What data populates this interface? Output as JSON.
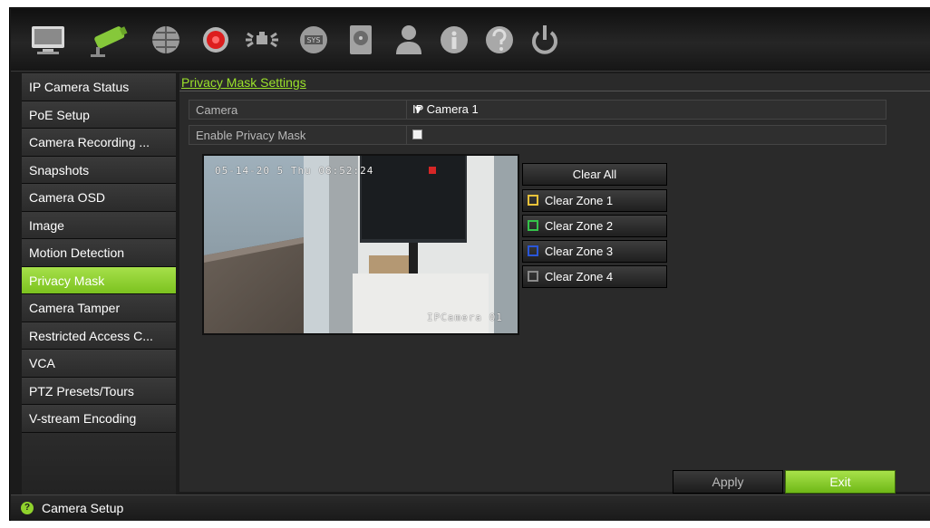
{
  "toolbar": {
    "icons": [
      "monitor-icon",
      "camera-icon",
      "network-icon",
      "record-icon",
      "alarm-icon",
      "device-icon",
      "hdd-icon",
      "user-icon",
      "info-icon",
      "help-icon",
      "power-icon"
    ]
  },
  "sidebar": {
    "items": [
      {
        "label": "IP Camera Status"
      },
      {
        "label": "PoE Setup"
      },
      {
        "label": "Camera Recording ..."
      },
      {
        "label": "Snapshots"
      },
      {
        "label": "Camera OSD"
      },
      {
        "label": "Image"
      },
      {
        "label": "Motion Detection"
      },
      {
        "label": "Privacy Mask",
        "active": true
      },
      {
        "label": "Camera Tamper"
      },
      {
        "label": "Restricted Access C..."
      },
      {
        "label": "VCA"
      },
      {
        "label": "PTZ Presets/Tours"
      },
      {
        "label": "V-stream Encoding"
      }
    ]
  },
  "content": {
    "title": "Privacy Mask Settings",
    "camera_label": "Camera",
    "camera_value": "IP Camera 1",
    "enable_label": "Enable Privacy Mask",
    "enable_checked": false,
    "osd_datetime": "05-14-20 5 Thu 08:52:24",
    "osd_camera_name": "IPCamera 01",
    "clear_all": "Clear All",
    "zones": [
      {
        "label": "Clear Zone 1",
        "color": "#e8c23a"
      },
      {
        "label": "Clear Zone 2",
        "color": "#35c24a"
      },
      {
        "label": "Clear Zone 3",
        "color": "#2a56d8"
      },
      {
        "label": "Clear Zone 4",
        "color": "#8a8a8a"
      }
    ],
    "apply": "Apply",
    "exit": "Exit"
  },
  "footer": {
    "label": "Camera Setup",
    "icon": "help-icon"
  },
  "colors": {
    "accent": "#8fd22c",
    "background": "#1b1b1b"
  }
}
